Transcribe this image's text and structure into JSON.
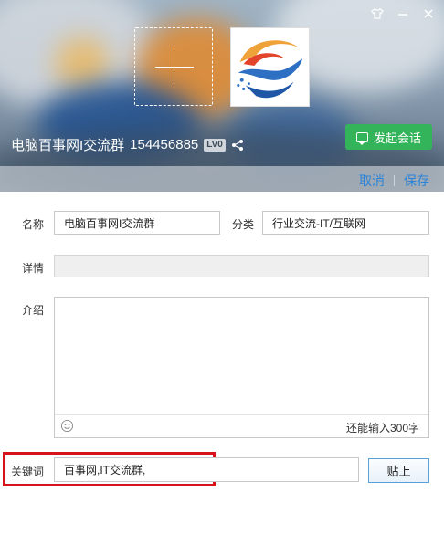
{
  "window": {
    "icons": [
      "shirt-icon",
      "minimize-icon",
      "close-icon"
    ],
    "accent_color": "#34b45a",
    "link_color": "#2a83d8",
    "highlight_color": "#d6121a"
  },
  "header": {
    "group_name": "电脑百事网I交流群",
    "group_id": "154456885",
    "level_badge": "LV0",
    "start_chat_label": "发起会话",
    "cancel_label": "取消",
    "save_label": "保存"
  },
  "form": {
    "name_label": "名称",
    "name_value": "电脑百事网I交流群",
    "category_label": "分类",
    "category_value": "行业交流-IT/互联网",
    "detail_label": "详情",
    "detail_value": "",
    "intro_label": "介绍",
    "intro_value": "",
    "remaining_text": "还能输入300字",
    "keyword_label": "关键词",
    "keyword_value": "百事网,IT交流群,",
    "paste_label": "贴上"
  }
}
